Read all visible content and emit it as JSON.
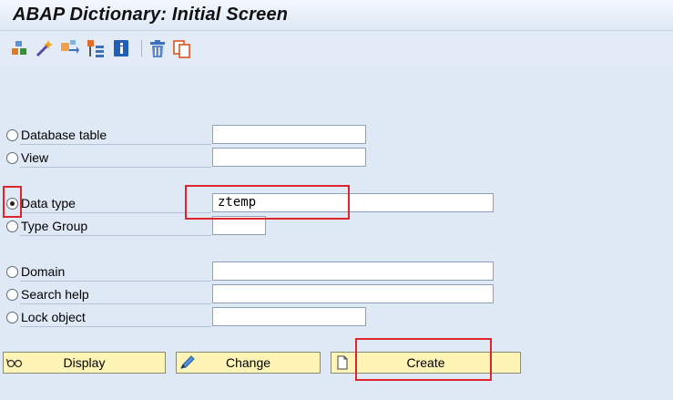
{
  "window": {
    "title": "ABAP Dictionary: Initial Screen"
  },
  "toolbar": {
    "icons": [
      "other-object-icon",
      "magic-wand-icon",
      "where-used-icon",
      "display-objects-icon",
      "information-icon",
      "delete-icon",
      "copy-icon"
    ]
  },
  "form": {
    "database_table": {
      "label": "Database table",
      "value": ""
    },
    "view": {
      "label": "View",
      "value": ""
    },
    "data_type": {
      "label": "Data type",
      "value": "ztemp",
      "selected": true
    },
    "type_group": {
      "label": "Type Group",
      "value": ""
    },
    "domain": {
      "label": "Domain",
      "value": ""
    },
    "search_help": {
      "label": "Search help",
      "value": ""
    },
    "lock_object": {
      "label": "Lock object",
      "value": ""
    }
  },
  "buttons": {
    "display": "Display",
    "change": "Change",
    "create": "Create"
  },
  "colors": {
    "background": "#dfe9f5",
    "button": "#fdf4b6",
    "highlight": "#e0242c"
  }
}
